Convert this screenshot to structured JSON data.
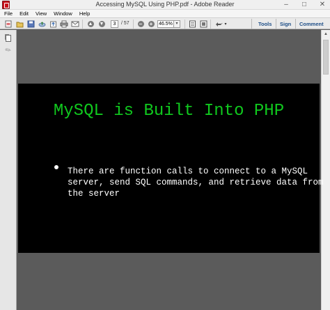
{
  "window": {
    "title": "Accessing MySQL Using PHP.pdf - Adobe Reader",
    "controls": {
      "minimize": "–",
      "maximize": "□",
      "close": "✕"
    }
  },
  "menu": [
    "File",
    "Edit",
    "View",
    "Window",
    "Help"
  ],
  "toolbar": {
    "page_current": "3",
    "page_total": "/ 57",
    "zoom": "46.5%",
    "zoom_dropdown": "▾",
    "tools_label": "Tools",
    "sign_label": "Sign",
    "comment_label": "Comment"
  },
  "slide": {
    "title": "MySQL is Built Into PHP",
    "body_lines": [
      "There are function calls to connect to a MySQL",
      "server, send SQL commands, and retrieve data from",
      "the server"
    ],
    "title_color": "#10c81e"
  },
  "icons": {
    "create": "create-pdf-icon",
    "open": "open-icon",
    "save": "save-icon",
    "cloud": "cloud-upload-icon",
    "print": "print-icon",
    "email": "email-icon",
    "prev": "prev-page-icon",
    "next": "next-page-icon",
    "zoom_out": "zoom-out-icon",
    "zoom_in": "zoom-in-icon",
    "fit_page": "fit-page-icon",
    "full_screen": "full-screen-icon",
    "read_mode": "read-mode-icon"
  }
}
